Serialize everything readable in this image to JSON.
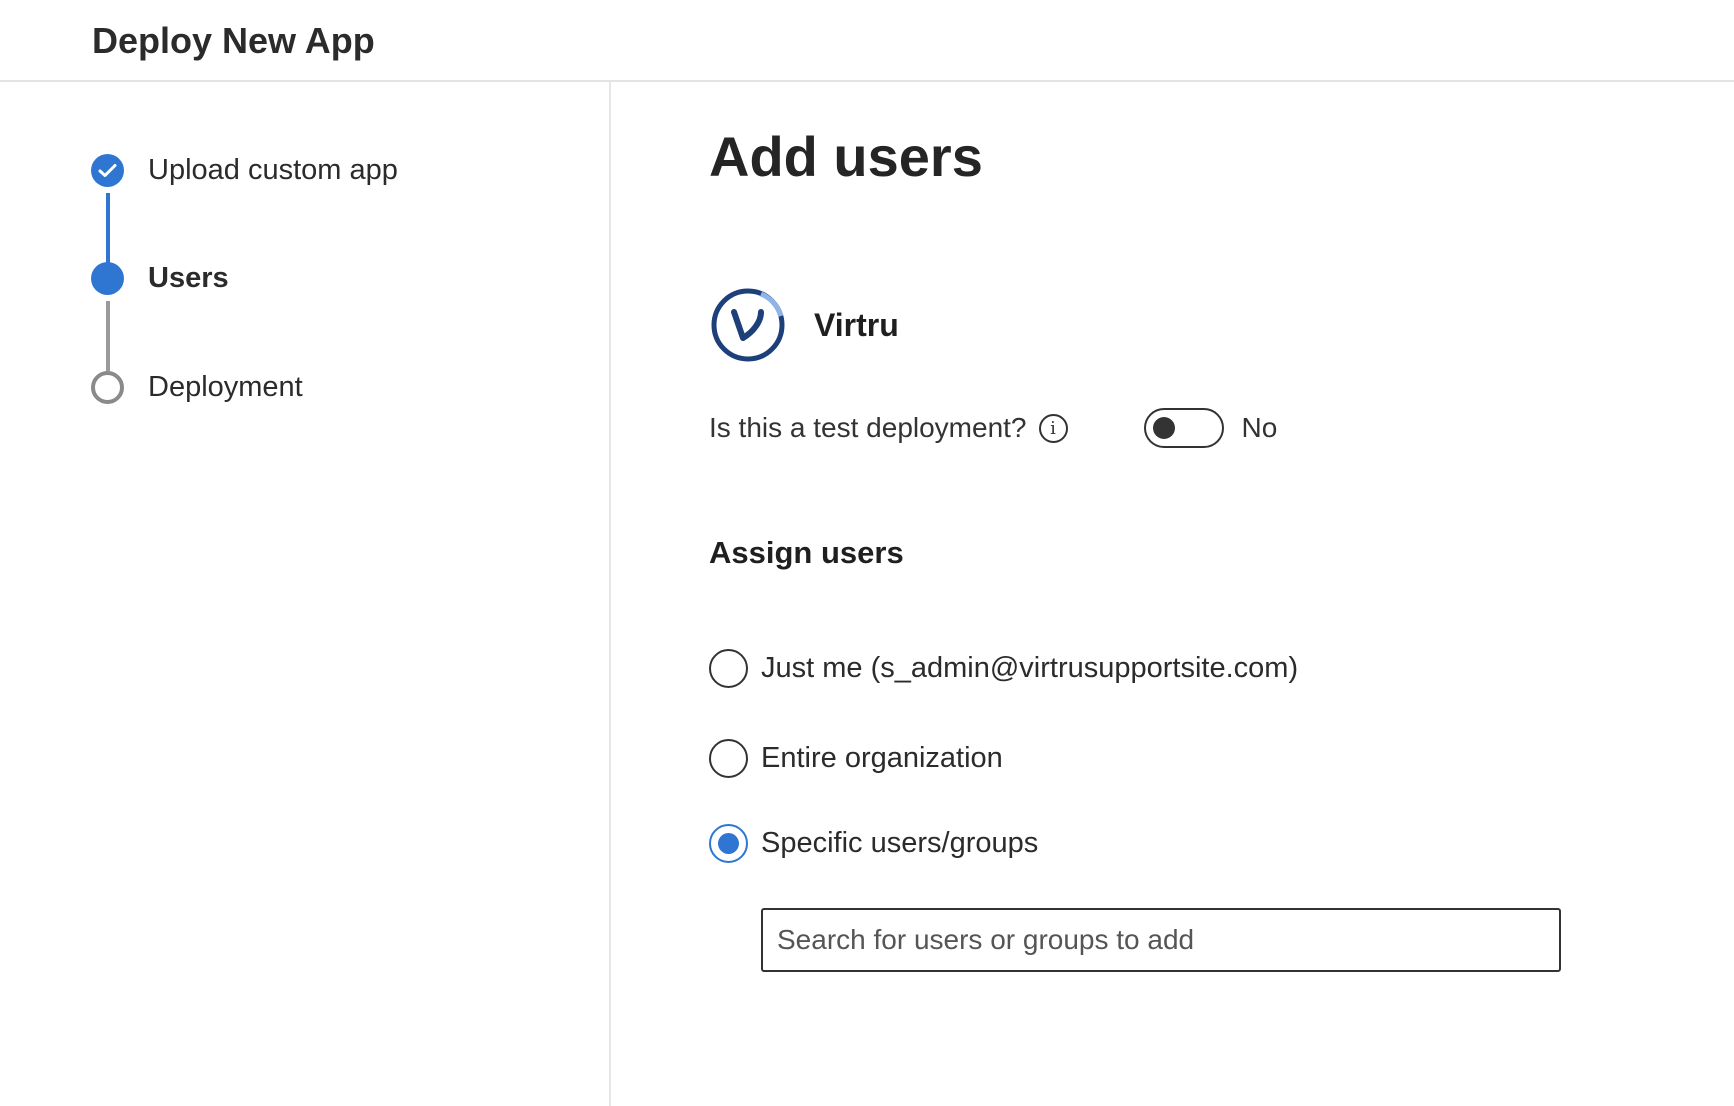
{
  "header": {
    "title": "Deploy New App"
  },
  "steps": [
    {
      "label": "Upload custom app",
      "state": "done"
    },
    {
      "label": "Users",
      "state": "current"
    },
    {
      "label": "Deployment",
      "state": "pending"
    }
  ],
  "main": {
    "title": "Add users",
    "app": {
      "name": "Virtru",
      "logo_icon": "virtru-logo-icon"
    },
    "test_deployment": {
      "question": "Is this a test deployment?",
      "toggle_value": "No",
      "toggle_on": false
    },
    "assign_users": {
      "heading": "Assign users",
      "options": [
        {
          "label": "Just me (s_admin@virtrusupportsite.com)",
          "selected": false
        },
        {
          "label": "Entire organization",
          "selected": false
        },
        {
          "label": "Specific users/groups",
          "selected": true
        }
      ],
      "search": {
        "placeholder": "Search for users or groups to add",
        "value": ""
      }
    }
  },
  "colors": {
    "accent": "#2f76d2",
    "virtru_blue": "#1d3f7a",
    "text": "#2b2b2b",
    "divider": "#e3e3e3"
  }
}
